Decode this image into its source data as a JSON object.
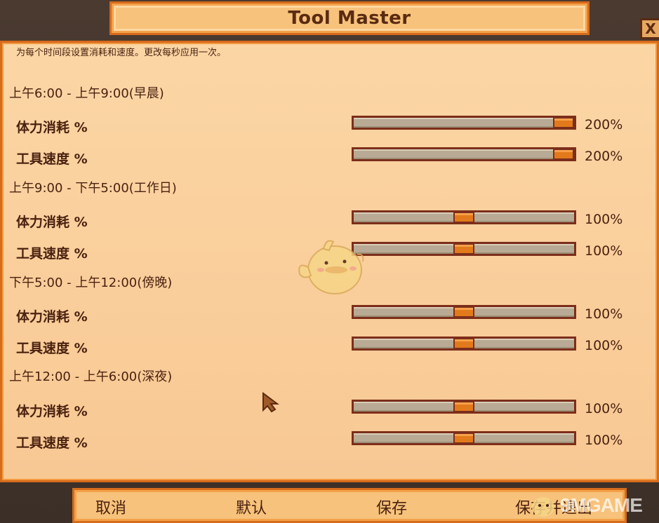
{
  "window": {
    "title": "Tool Master",
    "close_label": "X",
    "subtitle": "为每个时间段设置消耗和速度。更改每秒应用一次。"
  },
  "sections": [
    {
      "header": "上午6:00 - 上午9:00(早晨)",
      "rows": [
        {
          "label": "体力消耗 %",
          "value": "200%",
          "fraction": 1.0
        },
        {
          "label": "工具速度 %",
          "value": "200%",
          "fraction": 1.0
        }
      ]
    },
    {
      "header": "上午9:00 - 下午5:00(工作日)",
      "rows": [
        {
          "label": "体力消耗 %",
          "value": "100%",
          "fraction": 0.5
        },
        {
          "label": "工具速度 %",
          "value": "100%",
          "fraction": 0.5
        }
      ]
    },
    {
      "header": "下午5:00 - 上午12:00(傍晚)",
      "rows": [
        {
          "label": "体力消耗 %",
          "value": "100%",
          "fraction": 0.5
        },
        {
          "label": "工具速度 %",
          "value": "100%",
          "fraction": 0.5
        }
      ]
    },
    {
      "header": "上午12:00 - 上午6:00(深夜)",
      "rows": [
        {
          "label": "体力消耗 %",
          "value": "100%",
          "fraction": 0.5
        },
        {
          "label": "工具速度 %",
          "value": "100%",
          "fraction": 0.5
        }
      ]
    }
  ],
  "buttons": {
    "cancel": "取消",
    "default": "默认",
    "save": "保存",
    "save_exit": "保存并退出"
  },
  "watermark": "9MGAME",
  "colors": {
    "panel": "#fbd6a5",
    "border": "#d66b1c",
    "text": "#4a2210",
    "slider_track": "#b8aa94",
    "slider_thumb": "#e27a1c"
  },
  "icons": {
    "close": "close-icon",
    "mascot": "mascot-icon",
    "cursor": "cursor-icon"
  }
}
